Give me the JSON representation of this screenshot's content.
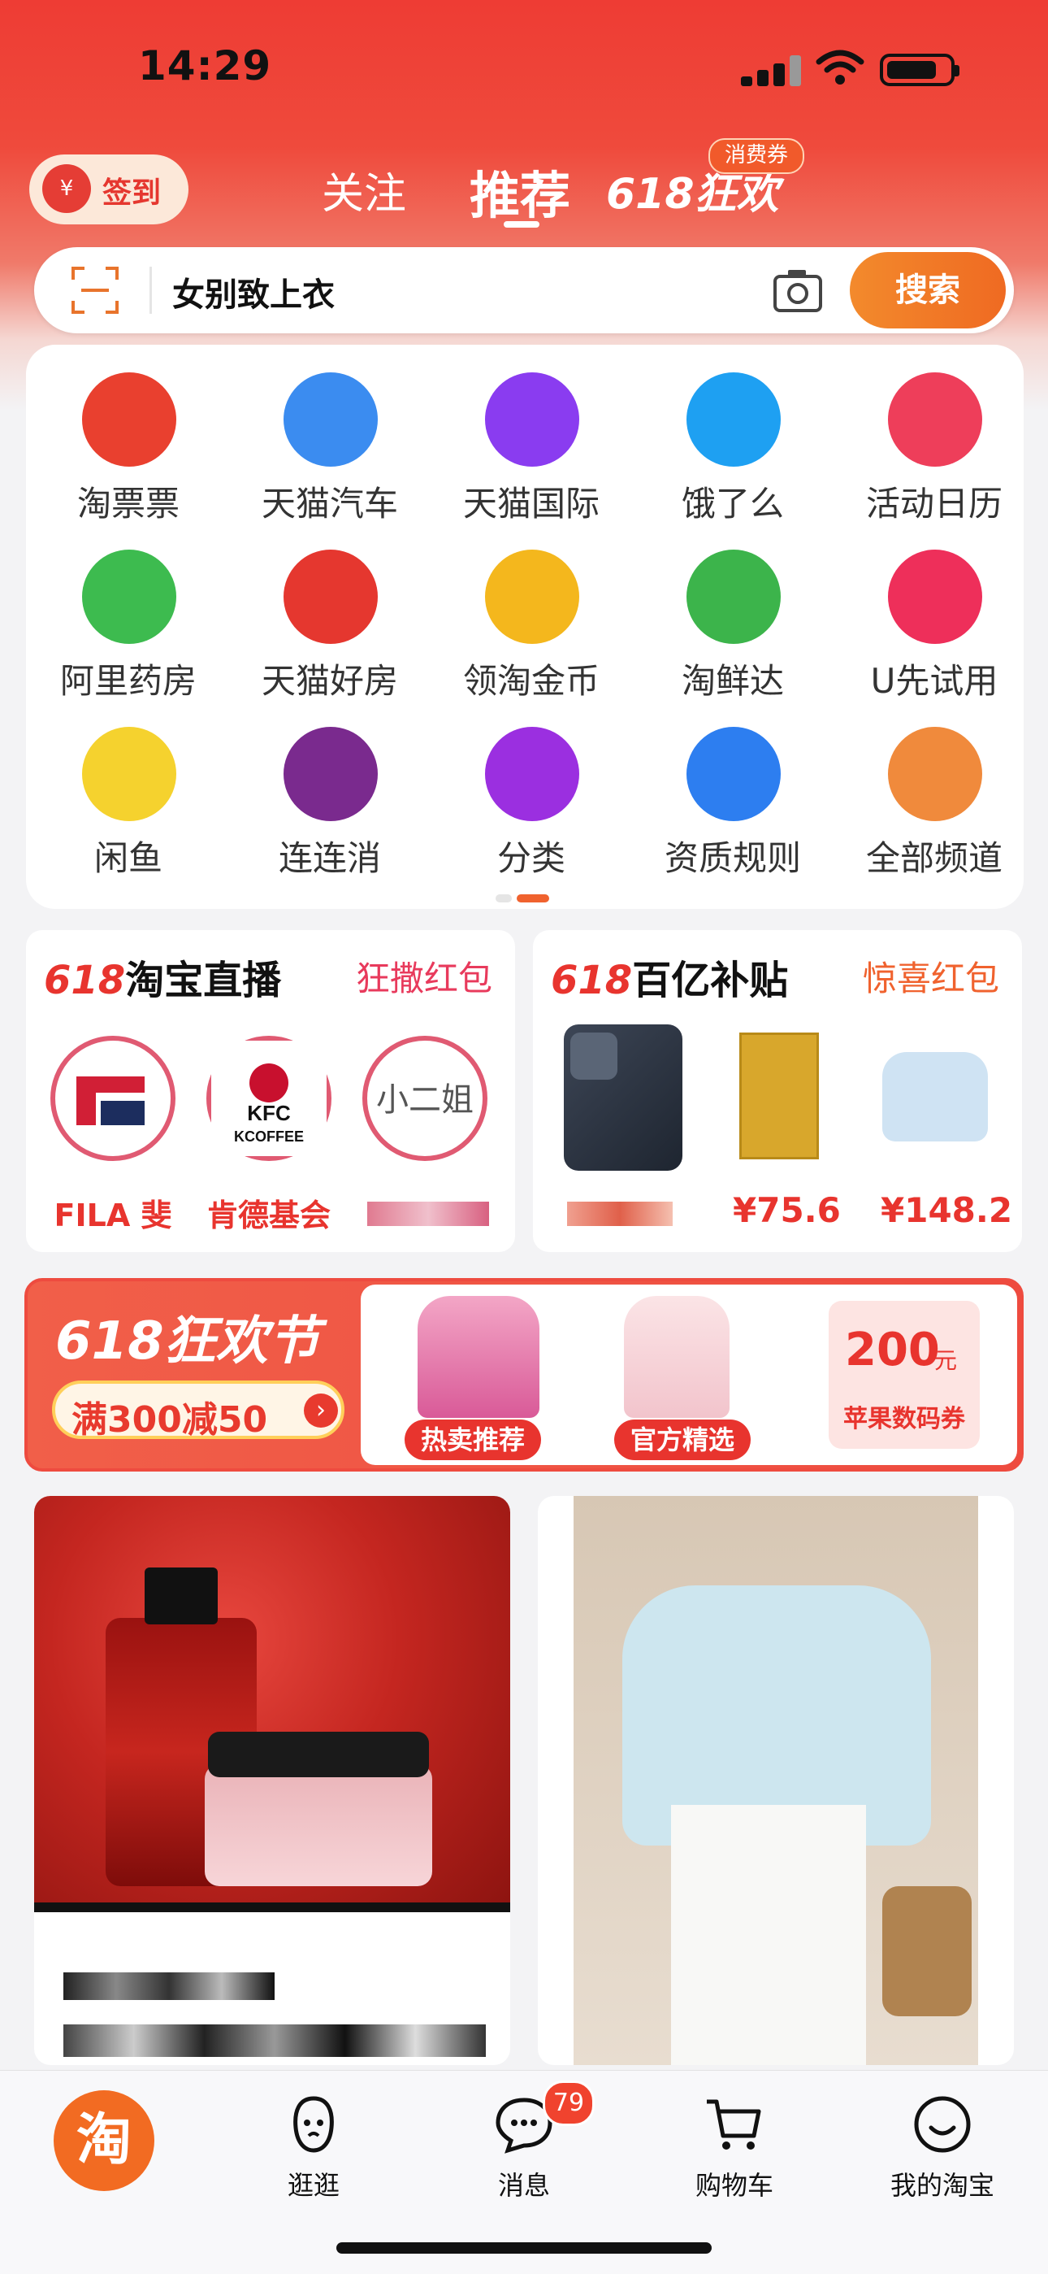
{
  "status": {
    "time": "14:29"
  },
  "topnav": {
    "checkin": "签到",
    "tabs": [
      "关注",
      "推荐",
      "618狂欢"
    ],
    "coupon_badge": "消费券"
  },
  "search": {
    "query": "女别致上衣",
    "button": "搜索"
  },
  "shortcuts": [
    {
      "label": "淘票票",
      "icon": "glasses-icon",
      "color": "#e9402f"
    },
    {
      "label": "天猫汽车",
      "icon": "car-icon",
      "color": "#3b8cf0"
    },
    {
      "label": "天猫国际",
      "icon": "plane-icon",
      "color": "#8a3cf0"
    },
    {
      "label": "饿了么",
      "icon": "eleme-icon",
      "color": "#1ea0f2"
    },
    {
      "label": "活动日历",
      "icon": "calendar-icon",
      "color": "#ee3e5a"
    },
    {
      "label": "阿里药房",
      "icon": "medicine-icon",
      "color": "#3dbb4f"
    },
    {
      "label": "天猫好房",
      "icon": "house-icon",
      "color": "#e5372f"
    },
    {
      "label": "领淘金币",
      "icon": "coin-icon",
      "color": "#f4b71d"
    },
    {
      "label": "淘鲜达",
      "icon": "grocery-icon",
      "color": "#3cb44b"
    },
    {
      "label": "U先试用",
      "icon": "u-icon",
      "color": "#ee2f5a"
    },
    {
      "label": "闲鱼",
      "icon": "fish-icon",
      "color": "#f5d22e"
    },
    {
      "label": "连连消",
      "icon": "bomb-icon",
      "color": "#7a2a8e"
    },
    {
      "label": "分类",
      "icon": "menu-icon",
      "color": "#9b2fe0"
    },
    {
      "label": "资质规则",
      "icon": "shield-check-icon",
      "color": "#2d7ef0"
    },
    {
      "label": "全部频道",
      "icon": "grid-apps-icon",
      "color": "#f08a3c"
    }
  ],
  "promos": {
    "live": {
      "prefix": "618",
      "title": "淘宝直播",
      "tag": "狂撒红包",
      "items": [
        {
          "name": "FILA 斐",
          "logo": "FILA"
        },
        {
          "name": "肯德基会",
          "logo": "KFC"
        },
        {
          "name": "",
          "logo": "小二姐"
        }
      ]
    },
    "subsidy": {
      "prefix": "618",
      "title": "百亿补贴",
      "tag": "惊喜红包",
      "items": [
        {
          "price": ""
        },
        {
          "price": "¥75.6"
        },
        {
          "price": "¥148.2"
        }
      ]
    }
  },
  "banner": {
    "title": "618狂欢节",
    "pill": "满300减50",
    "tags": [
      "热卖推荐",
      "官方精选"
    ],
    "voucher_amount": "200",
    "voucher_unit": "元",
    "voucher_label": "苹果数码券"
  },
  "tabbar": {
    "home": "淘",
    "items": [
      "逛逛",
      "消息",
      "购物车",
      "我的淘宝"
    ],
    "message_badge": "79"
  }
}
